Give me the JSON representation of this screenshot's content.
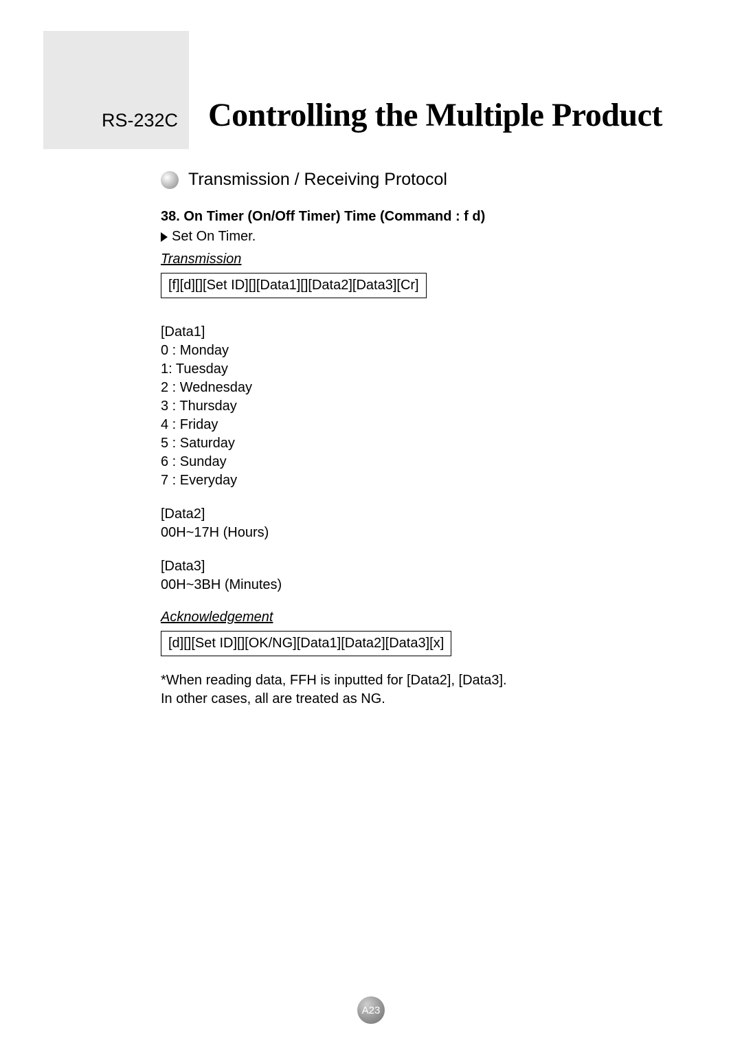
{
  "header": {
    "prefix": "RS-232C",
    "title": "Controlling the Multiple Product"
  },
  "section": {
    "title": "Transmission / Receiving Protocol"
  },
  "command": {
    "heading": "38. On Timer (On/Off Timer) Time (Command : f d)",
    "description": "Set On Timer."
  },
  "transmission": {
    "label": "Transmission",
    "code": "[f][d][][Set ID][][Data1][][Data2][Data3][Cr]"
  },
  "data1": {
    "label": "[Data1]",
    "items": [
      "0 : Monday",
      "1: Tuesday",
      "2 : Wednesday",
      "3 : Thursday",
      "4 : Friday",
      "5 : Saturday",
      "6 : Sunday",
      "7 : Everyday"
    ]
  },
  "data2": {
    "label": "[Data2]",
    "value": "00H~17H (Hours)"
  },
  "data3": {
    "label": "[Data3]",
    "value": "00H~3BH (Minutes)"
  },
  "acknowledgement": {
    "label": "Acknowledgement",
    "code": "[d][][Set ID][][OK/NG][Data1][Data2][Data3][x]"
  },
  "note": {
    "line1": "*When reading data, FFH is inputted for [Data2], [Data3].",
    "line2": "In other cases, all are treated as NG."
  },
  "page_number": "A23"
}
